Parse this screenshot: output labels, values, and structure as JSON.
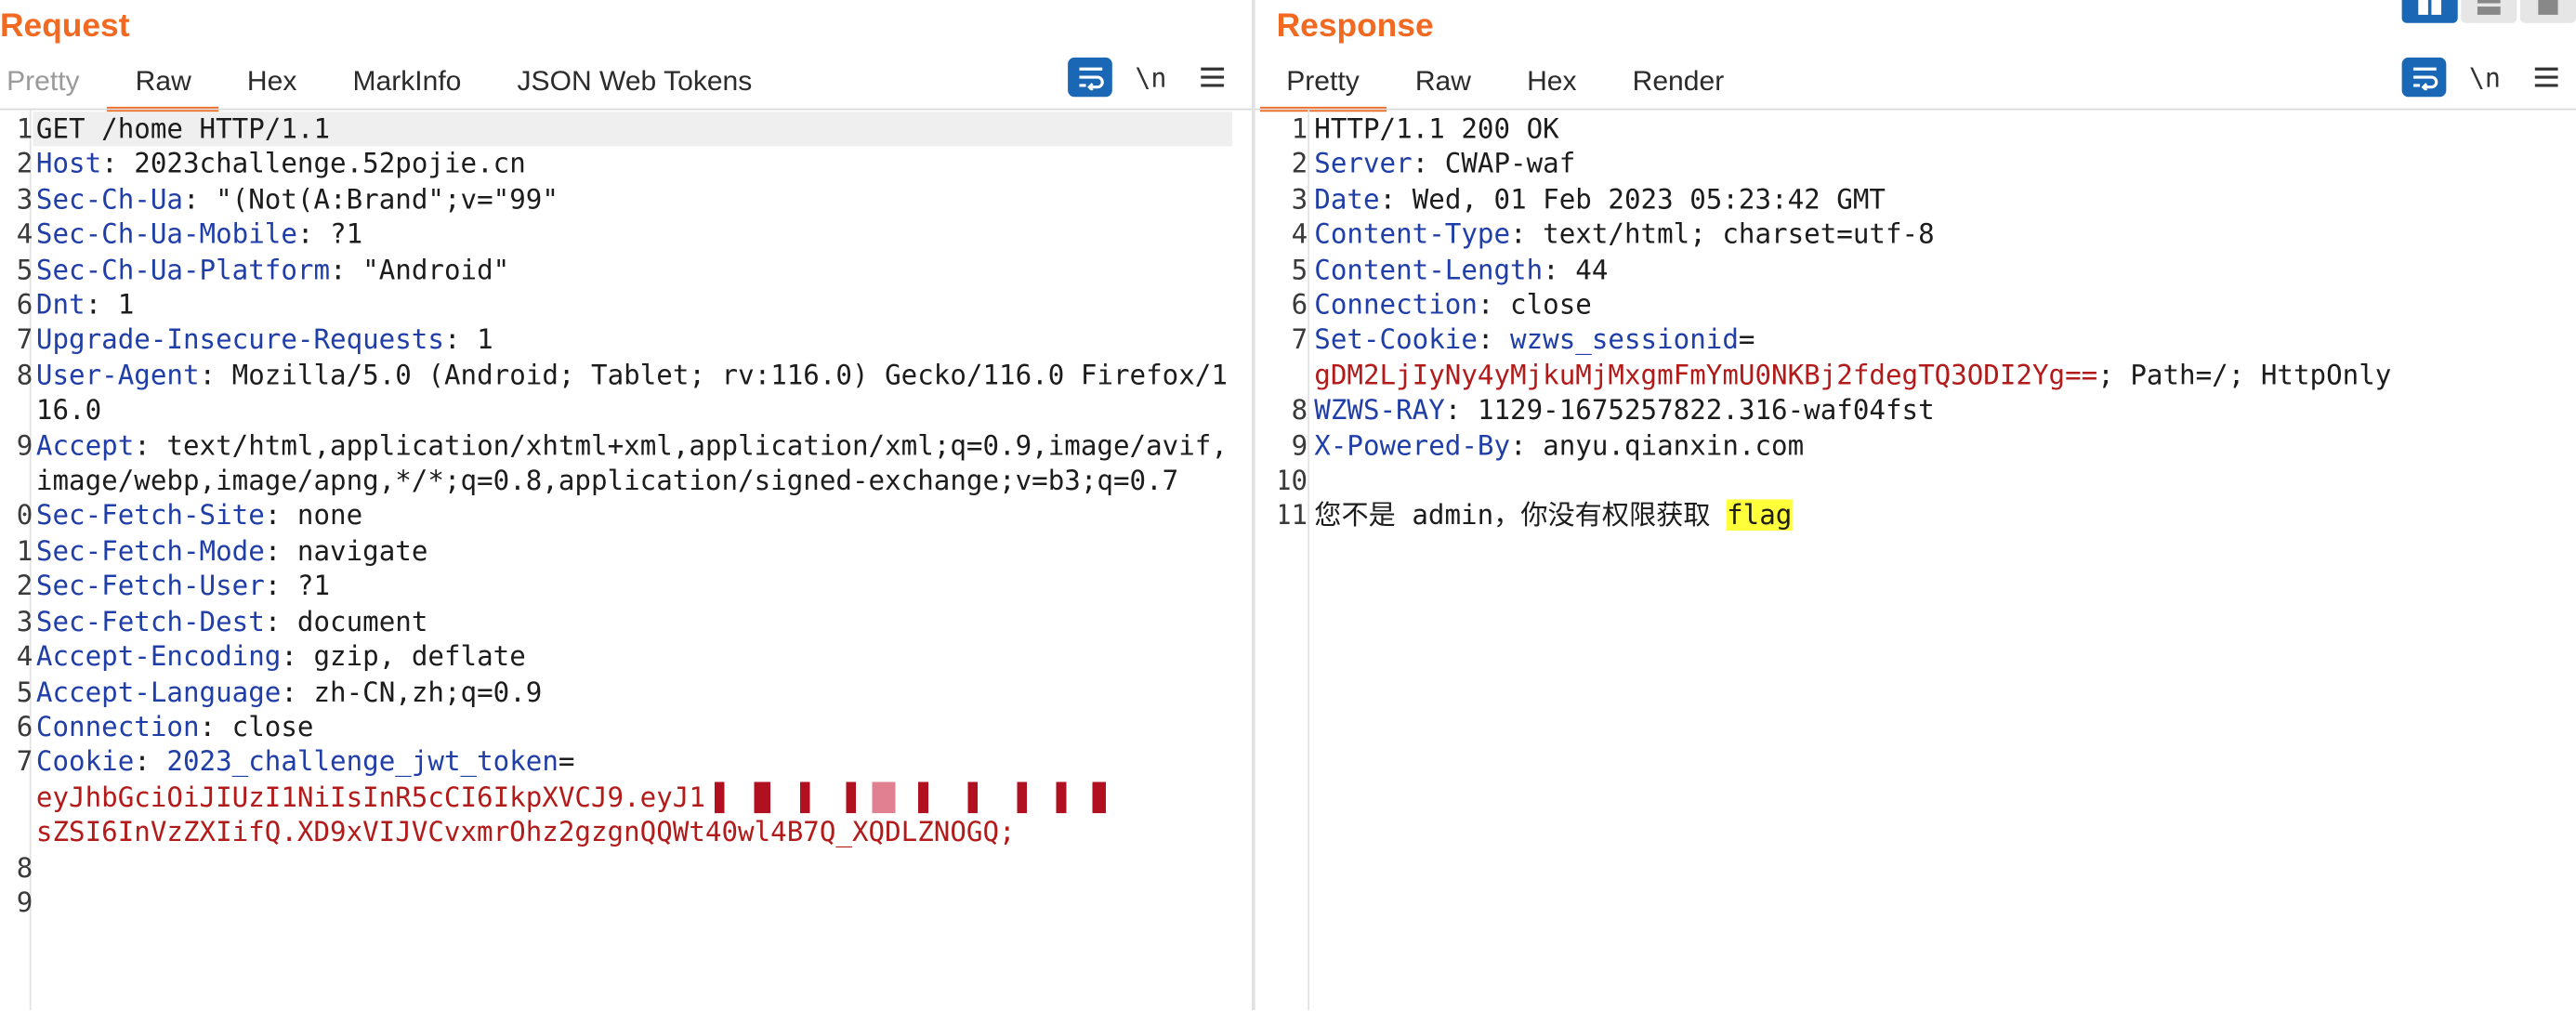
{
  "request": {
    "title": "Request",
    "tabs": [
      "Pretty",
      "Raw",
      "Hex",
      "MarkInfo",
      "JSON Web Tokens"
    ],
    "active_tab": "Raw",
    "newline_toggle": "\\n",
    "lines": [
      {
        "num": "1",
        "text": "GET /home HTTP/1.1"
      },
      {
        "num": "2",
        "name": "Host",
        "value": "2023challenge.52pojie.cn"
      },
      {
        "num": "3",
        "name": "Sec-Ch-Ua",
        "value": "\"(Not(A:Brand\";v=\"99\""
      },
      {
        "num": "4",
        "name": "Sec-Ch-Ua-Mobile",
        "value": "?1"
      },
      {
        "num": "5",
        "name": "Sec-Ch-Ua-Platform",
        "value": "\"Android\""
      },
      {
        "num": "6",
        "name": "Dnt",
        "value": "1"
      },
      {
        "num": "7",
        "name": "Upgrade-Insecure-Requests",
        "value": "1"
      },
      {
        "num": "8",
        "name": "User-Agent",
        "value": "Mozilla/5.0 (Android; Tablet; rv:116.0) Gecko/116.0 Firefox/116.0"
      },
      {
        "num": "9",
        "name": "Accept",
        "value": "text/html,application/xhtml+xml,application/xml;q=0.9,image/avif,image/webp,image/apng,*/*;q=0.8,application/signed-exchange;v=b3;q=0.7"
      },
      {
        "num": "0",
        "name": "Sec-Fetch-Site",
        "value": "none"
      },
      {
        "num": "1",
        "name": "Sec-Fetch-Mode",
        "value": "navigate"
      },
      {
        "num": "2",
        "name": "Sec-Fetch-User",
        "value": "?1"
      },
      {
        "num": "3",
        "name": "Sec-Fetch-Dest",
        "value": "document"
      },
      {
        "num": "4",
        "name": "Accept-Encoding",
        "value": "gzip, deflate"
      },
      {
        "num": "5",
        "name": "Accept-Language",
        "value": "zh-CN,zh;q=0.9"
      },
      {
        "num": "6",
        "name": "Connection",
        "value": "close"
      },
      {
        "num": "7",
        "name": "Cookie",
        "cookie_name": "2023_challenge_jwt_token",
        "cookie_value_1": "eyJhbGciOiJIUzI1NiIsInR5cCI6IkpXVCJ9.eyJ1",
        "cookie_value_2": "sZSI6InVzZXIifQ.XD9xVIJVCvxmrOhz2gzgnQQWt40wl4B7Q_XQDLZNOGQ;"
      },
      {
        "num": "8",
        "text": ""
      },
      {
        "num": "9",
        "text": ""
      }
    ]
  },
  "response": {
    "title": "Response",
    "tabs": [
      "Pretty",
      "Raw",
      "Hex",
      "Render"
    ],
    "active_tab": "Pretty",
    "newline_toggle": "\\n",
    "lines": [
      {
        "num": "1",
        "text": "HTTP/1.1 200 OK"
      },
      {
        "num": "2",
        "name": "Server",
        "value": "CWAP-waf"
      },
      {
        "num": "3",
        "name": "Date",
        "value": "Wed, 01 Feb 2023 05:23:42 GMT"
      },
      {
        "num": "4",
        "name": "Content-Type",
        "value": "text/html; charset=utf-8"
      },
      {
        "num": "5",
        "name": "Content-Length",
        "value": "44"
      },
      {
        "num": "6",
        "name": "Connection",
        "value": "close"
      },
      {
        "num": "7",
        "name": "Set-Cookie",
        "cookie_name": "wzws_sessionid",
        "cookie_value": "gDM2LjIyNy4yMjkuMjMxgmFmYmU0NKBj2fdegTQ3ODI2Yg==",
        "cookie_rest": "; Path=/; HttpOnly"
      },
      {
        "num": "8",
        "name": "WZWS-RAY",
        "value": "1129-1675257822.316-waf04fst"
      },
      {
        "num": "9",
        "name": "X-Powered-By",
        "value": "anyu.qianxin.com"
      },
      {
        "num": "10",
        "text": ""
      },
      {
        "num": "11",
        "body_text": "您不是 admin，你没有权限获取 ",
        "highlight": "flag"
      }
    ]
  },
  "icons": {
    "wrap": "text-wrap-icon",
    "menu": "hamburger-menu-icon",
    "layout": [
      "split-horizontal-icon",
      "split-vertical-icon",
      "single-pane-icon"
    ]
  },
  "colors": {
    "accent": "#f26a21",
    "header_name": "#1f3ea8",
    "cookie_value": "#b31a1a",
    "wrap_button": "#1a67b5",
    "highlight": "#ffff3a"
  }
}
